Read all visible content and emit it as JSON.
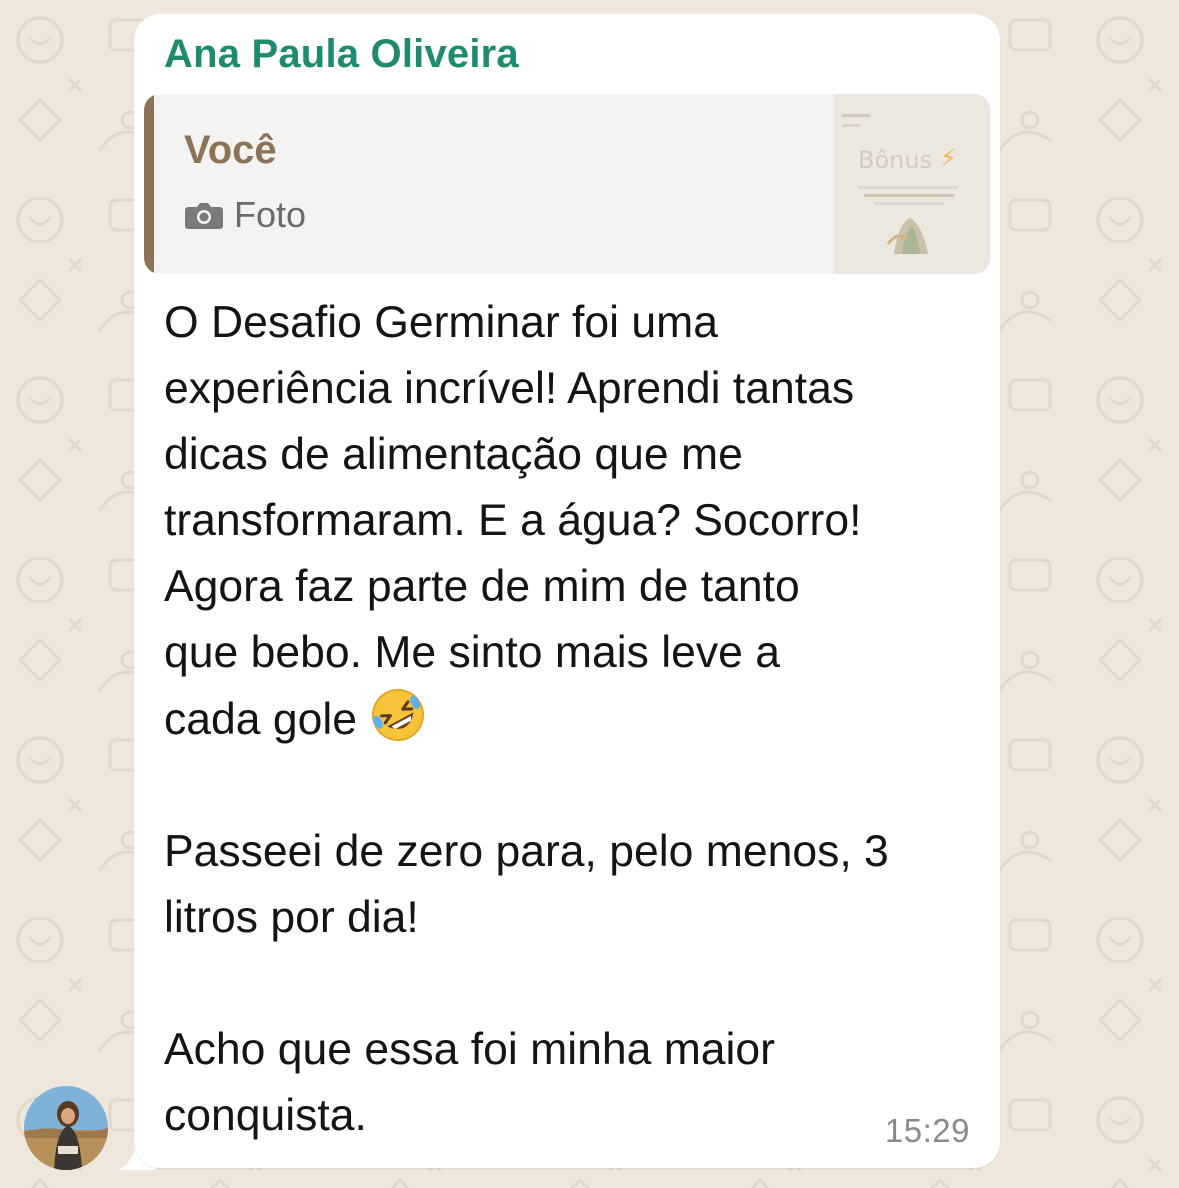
{
  "message": {
    "sender_name": "Ana Paula Oliveira",
    "quoted": {
      "author": "Você",
      "type_label": "Foto",
      "type_icon": "camera-icon",
      "thumbnail_text": "Bônus"
    },
    "text_part1": "O Desafio Germinar foi uma\nexperiência incrível! Aprendi tantas\ndicas de alimentação que me\ntransformaram. E a água? Socorro!\nAgora faz parte de mim de tanto\nque bebo. Me sinto mais leve a\ncada gole ",
    "emoji": "rolling-on-the-floor-laughing",
    "text_part2": "\n\nPasseei de zero para, pelo menos, 3\nlitros por dia!\n\nAcho que essa foi minha maior\nconquista.",
    "time": "15:29"
  },
  "colors": {
    "sender": "#1f8b6e",
    "quote_bar": "#8c7358",
    "wallpaper": "#efe7dc",
    "bubble": "#ffffff"
  }
}
